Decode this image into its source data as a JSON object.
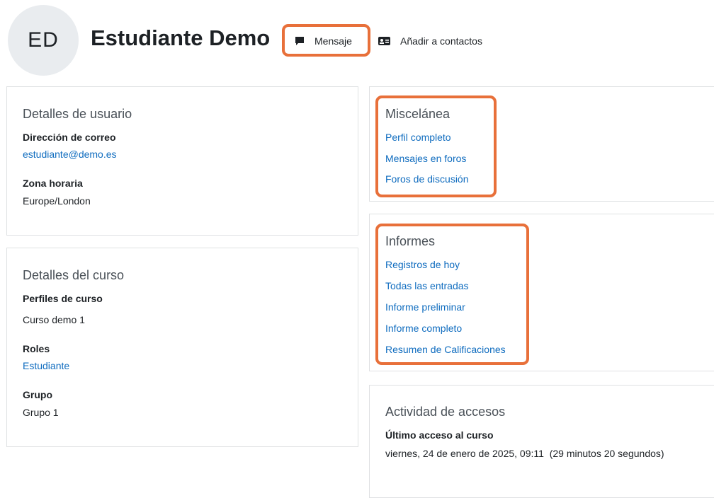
{
  "header": {
    "avatar_initials": "ED",
    "user_name": "Estudiante Demo",
    "message_label": "Mensaje",
    "add_contact_label": "Añadir a contactos",
    "message_icon": "chat-bubble-icon",
    "contact_icon": "address-card-icon"
  },
  "user_details": {
    "title": "Detalles de usuario",
    "email_label": "Dirección de correo",
    "email_value": "estudiante@demo.es",
    "timezone_label": "Zona horaria",
    "timezone_value": "Europe/London"
  },
  "course_details": {
    "title": "Detalles del curso",
    "profiles_label": "Perfiles de curso",
    "profiles_value": "Curso demo 1",
    "roles_label": "Roles",
    "roles_value": "Estudiante",
    "group_label": "Grupo",
    "group_value": "Grupo 1"
  },
  "misc": {
    "title": "Miscelánea",
    "links": [
      "Perfil completo",
      "Mensajes en foros",
      "Foros de discusión"
    ]
  },
  "reports": {
    "title": "Informes",
    "links": [
      "Registros de hoy",
      "Todas las entradas",
      "Informe preliminar",
      "Informe completo",
      "Resumen de Calificaciones"
    ]
  },
  "access": {
    "title": "Actividad de accesos",
    "last_access_label": "Último acceso al curso",
    "last_access_value": "viernes, 24 de enero de 2025, 09:11  (29 minutos 20 segundos)"
  },
  "colors": {
    "highlight": "#e8703a",
    "link": "#0f6cbf",
    "avatar_bg": "#e9ecef"
  }
}
